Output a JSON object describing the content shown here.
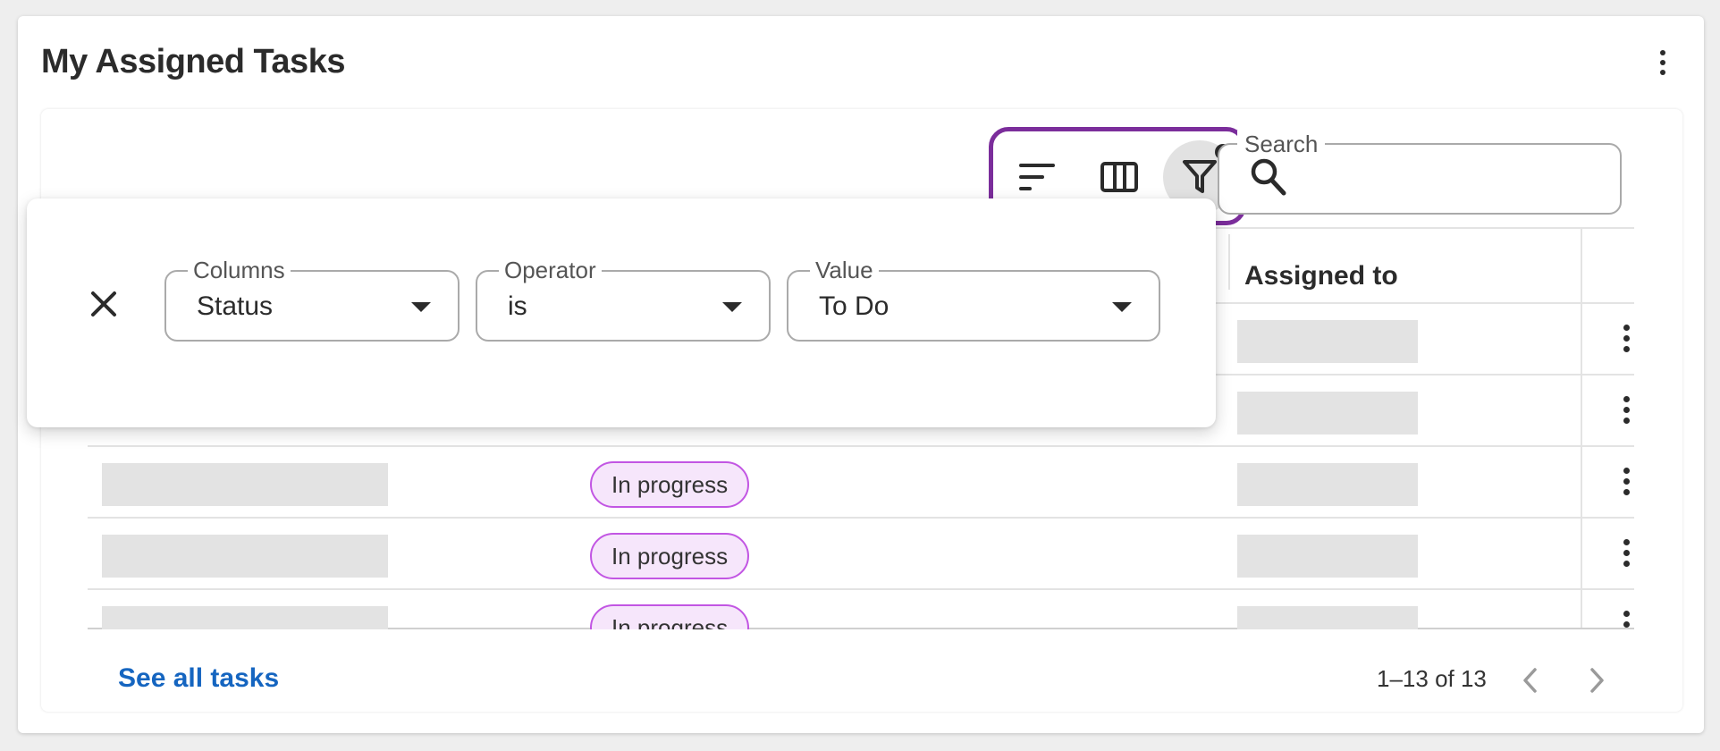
{
  "card": {
    "title": "My Assigned Tasks",
    "menu_icon": "more-vert-icon"
  },
  "toolbar": {
    "sort_icon": "sort-icon",
    "columns_icon": "view-column-icon",
    "filter_icon": "filter-icon",
    "filter_active": true,
    "highlight_color": "#7b2d9b"
  },
  "search": {
    "label": "Search",
    "value": "",
    "placeholder": ""
  },
  "table": {
    "visible_header": "Assigned to",
    "rows": [
      {
        "status": ""
      },
      {
        "status": ""
      },
      {
        "status": "In progress"
      },
      {
        "status": "In progress"
      },
      {
        "status": "In progress"
      }
    ],
    "status_color": "#c256e3"
  },
  "filter": {
    "columns": {
      "label": "Columns",
      "value": "Status"
    },
    "operator": {
      "label": "Operator",
      "value": "is"
    },
    "value": {
      "label": "Value",
      "value": "To Do"
    }
  },
  "footer": {
    "see_all": "See all tasks",
    "pagination": "1–13 of 13"
  }
}
